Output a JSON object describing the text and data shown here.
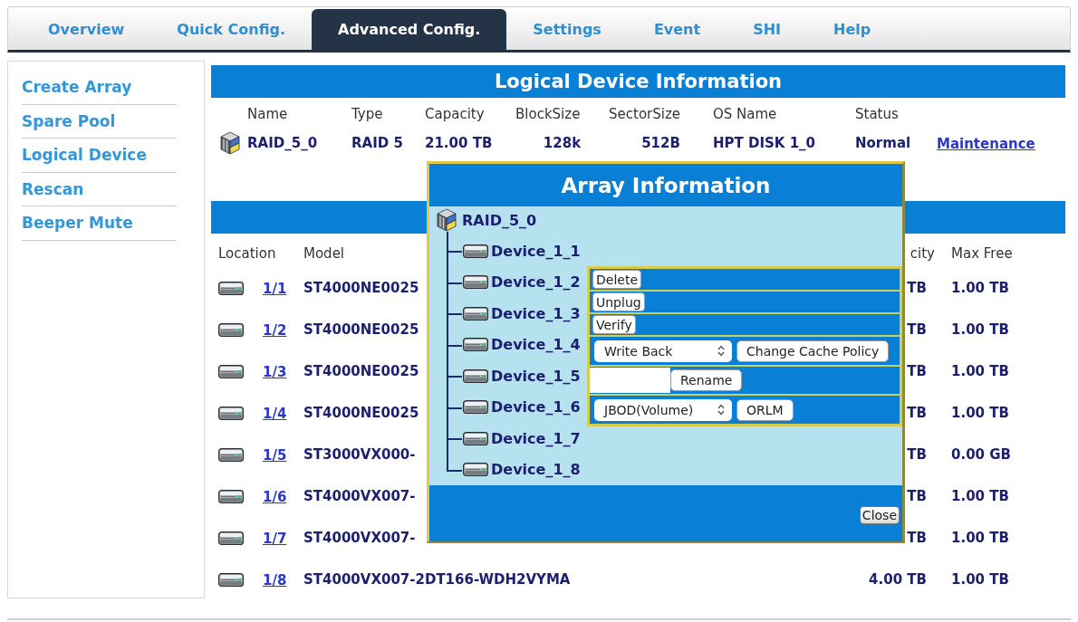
{
  "tabs": [
    {
      "label": "Overview",
      "selected": false
    },
    {
      "label": "Quick Config.",
      "selected": false
    },
    {
      "label": "Advanced Config.",
      "selected": true
    },
    {
      "label": "Settings",
      "selected": false
    },
    {
      "label": "Event",
      "selected": false
    },
    {
      "label": "SHI",
      "selected": false
    },
    {
      "label": "Help",
      "selected": false
    }
  ],
  "sidebar": {
    "items": [
      "Create Array",
      "Spare Pool",
      "Logical Device",
      "Rescan",
      "Beeper Mute"
    ]
  },
  "logical_device_info": {
    "title": "Logical Device Information",
    "columns": [
      "Name",
      "Type",
      "Capacity",
      "BlockSize",
      "SectorSize",
      "OS Name",
      "Status"
    ],
    "rows": [
      {
        "name": "RAID_5_0",
        "type": "RAID 5",
        "capacity": "21.00 TB",
        "block_size": "128k",
        "sector_size": "512B",
        "os_name": "HPT DISK 1_0",
        "status": "Normal",
        "action": "Maintenance"
      }
    ]
  },
  "physical_devices": {
    "columns": [
      "Location",
      "Model",
      "city",
      "Max Free"
    ],
    "rows": [
      {
        "location": "1/1",
        "model": "ST4000NE0025",
        "column_3": "TB",
        "max_free": "1.00 TB"
      },
      {
        "location": "1/2",
        "model": "ST4000NE0025",
        "column_3": "TB",
        "max_free": "1.00 TB"
      },
      {
        "location": "1/3",
        "model": "ST4000NE0025",
        "column_3": "TB",
        "max_free": "1.00 TB"
      },
      {
        "location": "1/4",
        "model": "ST4000NE0025",
        "column_3": "TB",
        "max_free": "1.00 TB"
      },
      {
        "location": "1/5",
        "model": "ST3000VX000-",
        "column_3": "TB",
        "max_free": "0.00 GB"
      },
      {
        "location": "1/6",
        "model": "ST4000VX007-",
        "column_3": "TB",
        "max_free": "1.00 TB"
      },
      {
        "location": "1/7",
        "model": "ST4000VX007-",
        "column_3": "TB",
        "max_free": "1.00 TB"
      },
      {
        "location": "1/8",
        "model": "ST4000VX007-2DT166-WDH2VYMA",
        "column_3": "4.00 TB",
        "max_free": "1.00 TB"
      }
    ]
  },
  "array_information": {
    "title": "Array Information",
    "tree": {
      "name": "RAID_5_0",
      "children": [
        {
          "name": "Device_1_1"
        },
        {
          "name": "Device_1_2"
        },
        {
          "name": "Device_1_3"
        },
        {
          "name": "Device_1_4"
        },
        {
          "name": "Device_1_5"
        },
        {
          "name": "Device_1_6"
        },
        {
          "name": "Device_1_7"
        },
        {
          "name": "Device_1_8"
        }
      ]
    },
    "actions": [
      {
        "kind": "button",
        "label": "Delete"
      },
      {
        "kind": "button",
        "label": "Unplug"
      },
      {
        "kind": "button",
        "label": "Verify"
      },
      {
        "kind": "select_button",
        "value": "Write Back",
        "button": "Change Cache Policy"
      },
      {
        "kind": "input_button",
        "button": "Rename"
      },
      {
        "kind": "select_button",
        "value": "JBOD(Volume)",
        "button": "ORLM"
      }
    ],
    "close": "Close"
  }
}
